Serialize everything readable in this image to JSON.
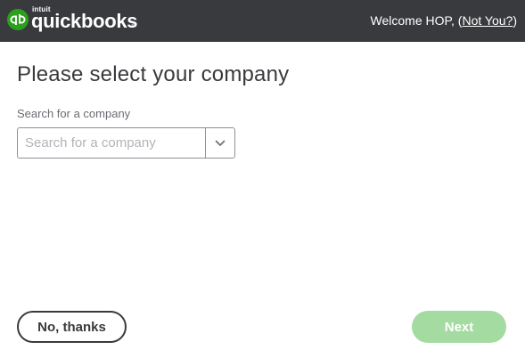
{
  "header": {
    "logo": {
      "brand_small": "intuit",
      "brand_name": "quickbooks",
      "trademark": "®",
      "icon": "qb-logo-icon",
      "icon_color": "#2ca01c"
    },
    "welcome_text": "Welcome HOP, (",
    "not_you_link": "Not You?",
    "welcome_close": ")",
    "background_color": "#393a3d"
  },
  "main": {
    "title": "Please select your company",
    "search": {
      "label": "Search for a company",
      "placeholder": "Search for a company",
      "value": "",
      "dropdown_icon": "chevron-down-icon"
    }
  },
  "footer": {
    "cancel_label": "No, thanks",
    "next_label": "Next",
    "next_color": "#a4dba0"
  }
}
